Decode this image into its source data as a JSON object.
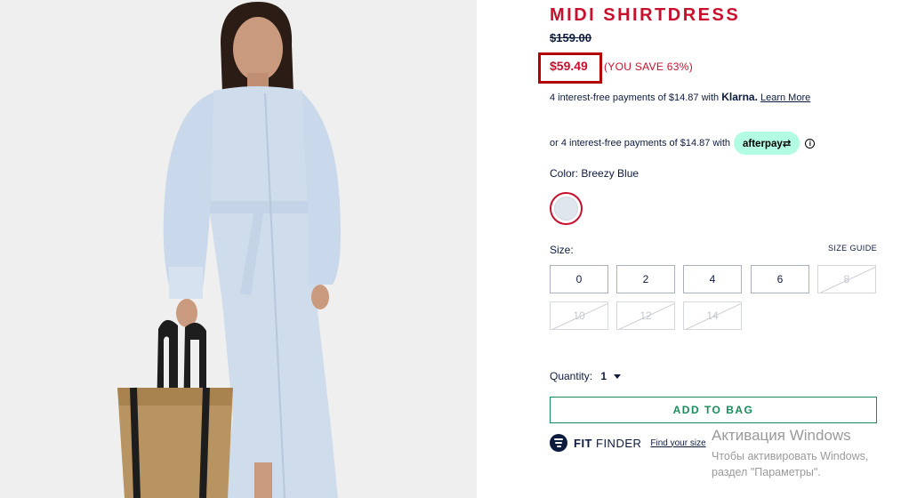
{
  "product": {
    "title": "MIDI SHIRTDRESS",
    "original_price": "$159.00",
    "sale_price": "$59.49",
    "savings": "(YOU SAVE 63%)"
  },
  "payments": {
    "klarna_text": "4 interest-free payments of $14.87 with",
    "klarna_brand": "Klarna.",
    "klarna_link": "Learn More",
    "afterpay_text": "or 4 interest-free payments of $14.87 with",
    "afterpay_brand": "afterpay⇄",
    "info_icon": "i"
  },
  "color": {
    "label": "Color:",
    "value": "Breezy Blue",
    "swatch_hex": "#dfe6ee"
  },
  "size": {
    "label": "Size:",
    "guide_label": "SIZE GUIDE",
    "options": [
      {
        "label": "0",
        "available": true
      },
      {
        "label": "2",
        "available": true
      },
      {
        "label": "4",
        "available": true
      },
      {
        "label": "6",
        "available": true
      },
      {
        "label": "8",
        "available": false
      },
      {
        "label": "10",
        "available": false
      },
      {
        "label": "12",
        "available": false
      },
      {
        "label": "14",
        "available": false
      }
    ]
  },
  "quantity": {
    "label": "Quantity:",
    "value": "1"
  },
  "actions": {
    "add_to_bag": "ADD TO BAG"
  },
  "fit_finder": {
    "brand": "FIT",
    "label": "FINDER",
    "link": "Find your size"
  },
  "watermark": {
    "title": "Активация Windows",
    "line1": "Чтобы активировать Windows,",
    "line2": "раздел \"Параметры\"."
  },
  "colors": {
    "brand_red": "#c8102e",
    "navy": "#0d1b3d",
    "cta_green": "#1a8c5a",
    "afterpay_mint": "#b2fce4"
  }
}
